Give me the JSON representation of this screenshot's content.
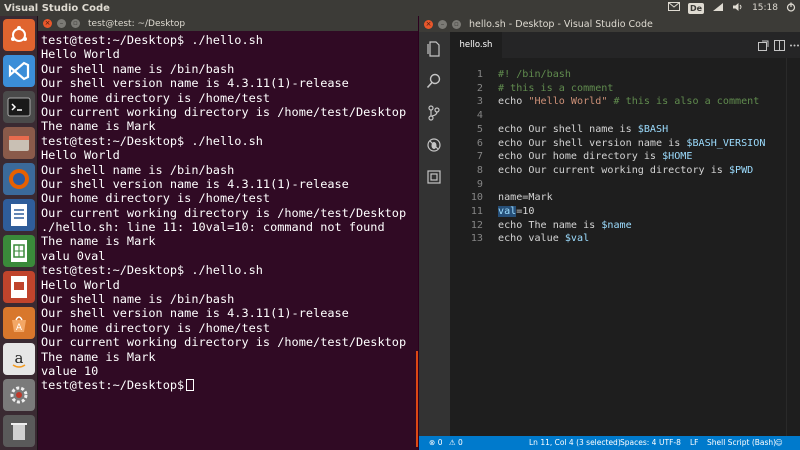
{
  "top_panel": {
    "app_title": "Visual Studio Code",
    "keyboard_layout": "De",
    "clock": "15:18"
  },
  "launcher": {
    "items": [
      "ubuntu-dash",
      "vscode",
      "terminal",
      "files",
      "firefox",
      "writer",
      "calc",
      "impress",
      "software-center",
      "amazon",
      "system-settings",
      "trash"
    ]
  },
  "terminal": {
    "title": "test@test: ~/Desktop",
    "lines": [
      "test@test:~/Desktop$ ./hello.sh",
      "Hello World",
      "Our shell name is /bin/bash",
      "Our shell version name is 4.3.11(1)-release",
      "Our home directory is /home/test",
      "Our current working directory is /home/test/Desktop",
      "The name is Mark",
      "test@test:~/Desktop$ ./hello.sh",
      "Hello World",
      "Our shell name is /bin/bash",
      "Our shell version name is 4.3.11(1)-release",
      "Our home directory is /home/test",
      "Our current working directory is /home/test/Desktop",
      "./hello.sh: line 11: 10val=10: command not found",
      "The name is Mark",
      "valu 0val",
      "test@test:~/Desktop$ ./hello.sh",
      "Hello World",
      "Our shell name is /bin/bash",
      "Our shell version name is 4.3.11(1)-release",
      "Our home directory is /home/test",
      "Our current working directory is /home/test/Desktop",
      "The name is Mark",
      "value 10"
    ],
    "prompt": "test@test:~/Desktop$"
  },
  "vscode": {
    "title": "hello.sh - Desktop - Visual Studio Code",
    "tab_label": "hello.sh",
    "lines": [
      {
        "n": "1",
        "tokens": [
          {
            "t": "#! /bin/bash",
            "c": "comment"
          }
        ]
      },
      {
        "n": "2",
        "tokens": [
          {
            "t": "# this is a comment",
            "c": "comment"
          }
        ]
      },
      {
        "n": "3",
        "tokens": [
          {
            "t": "echo ",
            "c": "plain"
          },
          {
            "t": "\"Hello World\"",
            "c": "string"
          },
          {
            "t": " # this is also a comment",
            "c": "comment"
          }
        ]
      },
      {
        "n": "4",
        "tokens": []
      },
      {
        "n": "5",
        "tokens": [
          {
            "t": "echo Our shell name is ",
            "c": "plain"
          },
          {
            "t": "$BASH",
            "c": "var"
          }
        ]
      },
      {
        "n": "6",
        "tokens": [
          {
            "t": "echo Our shell version name is ",
            "c": "plain"
          },
          {
            "t": "$BASH_VERSION",
            "c": "var"
          }
        ]
      },
      {
        "n": "7",
        "tokens": [
          {
            "t": "echo Our home directory is ",
            "c": "plain"
          },
          {
            "t": "$HOME",
            "c": "var"
          }
        ]
      },
      {
        "n": "8",
        "tokens": [
          {
            "t": "echo Our current working directory is ",
            "c": "plain"
          },
          {
            "t": "$PWD",
            "c": "var"
          }
        ]
      },
      {
        "n": "9",
        "tokens": []
      },
      {
        "n": "10",
        "tokens": [
          {
            "t": "name=Mark",
            "c": "plain"
          }
        ]
      },
      {
        "n": "11",
        "tokens": [
          {
            "t": "val",
            "c": "sel"
          },
          {
            "t": "=10",
            "c": "plain"
          }
        ]
      },
      {
        "n": "12",
        "tokens": [
          {
            "t": "echo The name is ",
            "c": "plain"
          },
          {
            "t": "$name",
            "c": "var"
          }
        ]
      },
      {
        "n": "13",
        "tokens": [
          {
            "t": "echo ",
            "c": "plain"
          },
          {
            "t": "value ",
            "c": "plain"
          },
          {
            "t": "$val",
            "c": "var"
          }
        ]
      }
    ],
    "status": {
      "errors": "0",
      "warnings": "0",
      "position": "Ln 11, Col 4 (3 selected)",
      "spaces": "Spaces: 4",
      "encoding": "UTF-8",
      "eol": "LF",
      "language": "Shell Script (Bash)"
    }
  },
  "colors": {
    "terminal_bg": "#300a24",
    "panel_bg": "#3c3b37",
    "vscode_bg": "#1e1e1e",
    "statusbar_bg": "#007acc",
    "close_button": "#e9572b"
  }
}
